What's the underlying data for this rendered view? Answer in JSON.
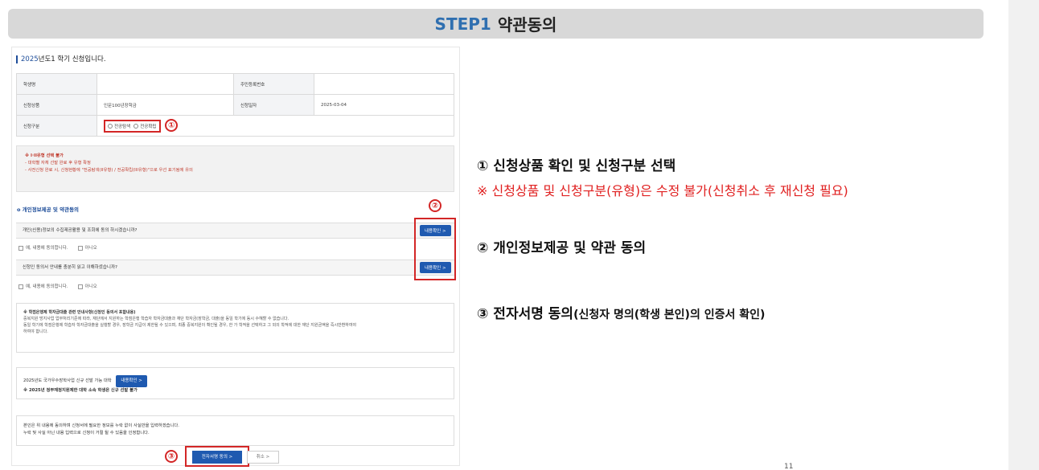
{
  "header": {
    "step": "STEP1",
    "title": "약관동의"
  },
  "shot": {
    "title_year": "2025",
    "title_rest": "년도1 학기 신청입니다.",
    "table": {
      "student_label": "학생명",
      "student_value": "",
      "rrn_label": "주민등록번호",
      "rrn_value": "",
      "product_label": "신청상품",
      "product_value": "인문100년장학금",
      "date_label": "신청일자",
      "date_value": "2025-03-04",
      "type_label": "신청구분",
      "type_opt1": "전공탐색",
      "type_opt2": "전공확립"
    },
    "notice": {
      "line1": "※ I·II유형 선택 불가",
      "line2": "- 대학별 자체 선발 완료 후 유형 확정",
      "line3": "- 사전신청 완료 시, 신청현황에 \"전공탐색(II유형) / 전공확립(III유형)\"으로 우선 표기됨에 유의"
    },
    "section_title": "개인정보제공 및 약관동의",
    "agree1": "개인(신용)정보의 수집제공활용 및 조회에 동의 하시겠습니까?",
    "agree2": "신청인 동의서 안내를 충분히 읽고 이해하셨습니까?",
    "yes_label": "예, 내용에 동의합니다.",
    "no_label": "아니오",
    "detail_button": "내용확인 >",
    "guide": {
      "title": "※ 학점은행제 학자금대출 관련 안내사항(신청인 동의서 포함내용)",
      "line1": "중복지원 방지사업 업무처리기준에 따라, 재단에서 지원하는 학점은행 학습자 학자금대출과 재단 학자금(장학금, 대출)을 동일 학기에 동시 수혜할 수 없습니다.",
      "line2": "동일 학기에 학점은행제 학습자 학자금대출을 실행할 경우, 장학금 지급이 제한될 수 있으며, 최종 중복지원이 확인될 경우, 한 가 학적을 선택하고 그 외의 학적에 대한 재단 지원금액을 즉시반환하여야",
      "line3": "하여야 합니다."
    },
    "scholar": {
      "line1": "2025년도 국가우수장학사업 신규 선발 가능 대학",
      "line2": "※ 2025년 정부재정지원제한 대학 소속 학생은 신규 선발 불가"
    },
    "confirm": {
      "line1": "본인은 위 내용에 동의하며 신청서에 필요한 정보를 누락 없이 사실만을 입력하겠습니다.",
      "line2": "누락 및 사실 아닌 내용 입력으로 신청이 거절 될 수 있음을 인정합니다."
    },
    "sign_button": "전자서명 동의 >",
    "cancel_button": "취소 >"
  },
  "markers": {
    "m1": "①",
    "m2": "②",
    "m3": "③"
  },
  "explanations": {
    "e1": "① 신청상품 확인 및 신청구분 선택",
    "e1_note": "※ 신청상품 및 신청구분(유형)은 수정 불가(신청취소 후 재신청 필요)",
    "e2": "② 개인정보제공 및 약관 동의",
    "e3_main": "③ 전자서명 동의",
    "e3_sub": "(신청자 명의(학생 본인)의 인증서 확인)"
  },
  "page_mark": "11",
  "colors": {
    "accent_blue": "#2f6fb0",
    "marker_red": "#d32626",
    "note_red": "#e02020",
    "button_blue": "#1f5ab0"
  }
}
